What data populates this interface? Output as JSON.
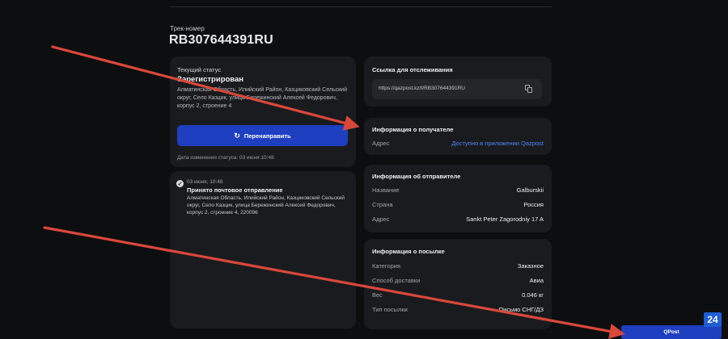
{
  "header": {
    "track_label": "Трек-номер",
    "track_number": "RB307644391RU"
  },
  "status": {
    "caption": "Текущий статус",
    "value": "Зарегистрирован",
    "address": "Алматинская Область, Илийский Район, Казциковский Сельский округ, Село Казцик, улица Бережинский Алексей Федорович, корпус 2, строение 4",
    "redirect_label": "Перенаправить",
    "redirect_icon": "↻",
    "change_date": "Дата изменения статуса: 03 июня 10:48"
  },
  "history": [
    {
      "date": "03 июня, 10:48",
      "title": "Принято почтовое отправление",
      "address": "Алматинская Область, Илийский Район, Казциковский Сельский округ, Село Казцик, улица Бережинский Алексей Федорович, корпус 2, строение 4, 220096"
    }
  ],
  "tracking_link": {
    "title": "Ссылка для отслеживания",
    "url": "https://qazpost.kz/t/RB307644391RU"
  },
  "recipient": {
    "title": "Информация о получателе",
    "address_key": "Адрес",
    "address_value": "Доступно в приложении Qazpost"
  },
  "sender": {
    "title": "Информация об отправителе",
    "rows": [
      {
        "key": "Название",
        "value": "Galburskii"
      },
      {
        "key": "Страна",
        "value": "Россия"
      },
      {
        "key": "Адрес",
        "value": "Sankt Peter Zagorodniy 17 A"
      }
    ]
  },
  "parcel": {
    "title": "Информация о посылке",
    "rows": [
      {
        "key": "Категория",
        "value": "Заказное"
      },
      {
        "key": "Способ доставки",
        "value": "Авиа"
      },
      {
        "key": "Вес",
        "value": "0.046 кг"
      },
      {
        "key": "Тип посылки",
        "value": "Письмо СНГ/ДЗ"
      }
    ]
  },
  "footer": {
    "qpost_label": "QPost",
    "badge": "24"
  },
  "colors": {
    "accent": "#1e3fc0",
    "link": "#4f86ff",
    "annotation_arrow": "#d9483b"
  }
}
